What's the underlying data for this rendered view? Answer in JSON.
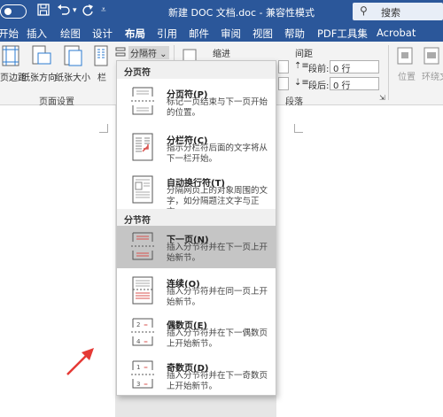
{
  "titlebar": {
    "autosave": "",
    "title": "新建 DOC 文档.doc  -  兼容性模式",
    "search_label": "搜索",
    "save_icon": "save-icon",
    "undo_icon": "undo-icon",
    "redo_icon": "redo-icon"
  },
  "tabs": [
    {
      "label": "开始"
    },
    {
      "label": "插入"
    },
    {
      "label": "绘图"
    },
    {
      "label": "设计"
    },
    {
      "label": "布局",
      "active": true
    },
    {
      "label": "引用"
    },
    {
      "label": "邮件"
    },
    {
      "label": "审阅"
    },
    {
      "label": "视图"
    },
    {
      "label": "帮助"
    },
    {
      "label": "PDF工具集"
    },
    {
      "label": "Acrobat"
    }
  ],
  "ribbon": {
    "margins_label": "页边距",
    "orientation_label": "纸张方向",
    "size_label": "纸张大小",
    "columns_label": "栏",
    "breaks_label": "分隔符",
    "indent_label": "缩进",
    "spacing_label": "间距",
    "before_label": "段前:",
    "before_value": "0 行",
    "after_label": "段后:",
    "after_value": "0 行",
    "page_setup_group": "页面设置",
    "paragraph_group": "段落",
    "position_label": "位置",
    "wrap_label": "环绕文字"
  },
  "menu": {
    "page_breaks_header": "分页符",
    "section_breaks_header": "分节符",
    "items": [
      {
        "title": "分页符(P)",
        "desc": "标记一页结束与下一页开始的位置。",
        "icon": "page-break-icon"
      },
      {
        "title": "分栏符(C)",
        "desc": "指示分栏符后面的文字将从下一栏开始。",
        "icon": "column-break-icon"
      },
      {
        "title": "自动换行符(T)",
        "desc": "分隔网页上的对象周围的文字，如分隔题注文字与正文。",
        "icon": "text-wrapping-break-icon"
      },
      {
        "title": "下一页(N)",
        "desc": "插入分节符并在下一页上开始新节。",
        "icon": "next-page-section-icon"
      },
      {
        "title": "连续(O)",
        "desc": "插入分节符并在同一页上开始新节。",
        "icon": "continuous-section-icon"
      },
      {
        "title": "偶数页(E)",
        "desc": "插入分节符并在下一偶数页上开始新节。",
        "icon": "even-page-section-icon"
      },
      {
        "title": "奇数页(D)",
        "desc": "插入分节符并在下一奇数页上开始新节。",
        "icon": "odd-page-section-icon"
      }
    ]
  },
  "colors": {
    "title_bar": "#2b579a",
    "highlight": "#c5c5c5",
    "arrow": "#e53935"
  }
}
